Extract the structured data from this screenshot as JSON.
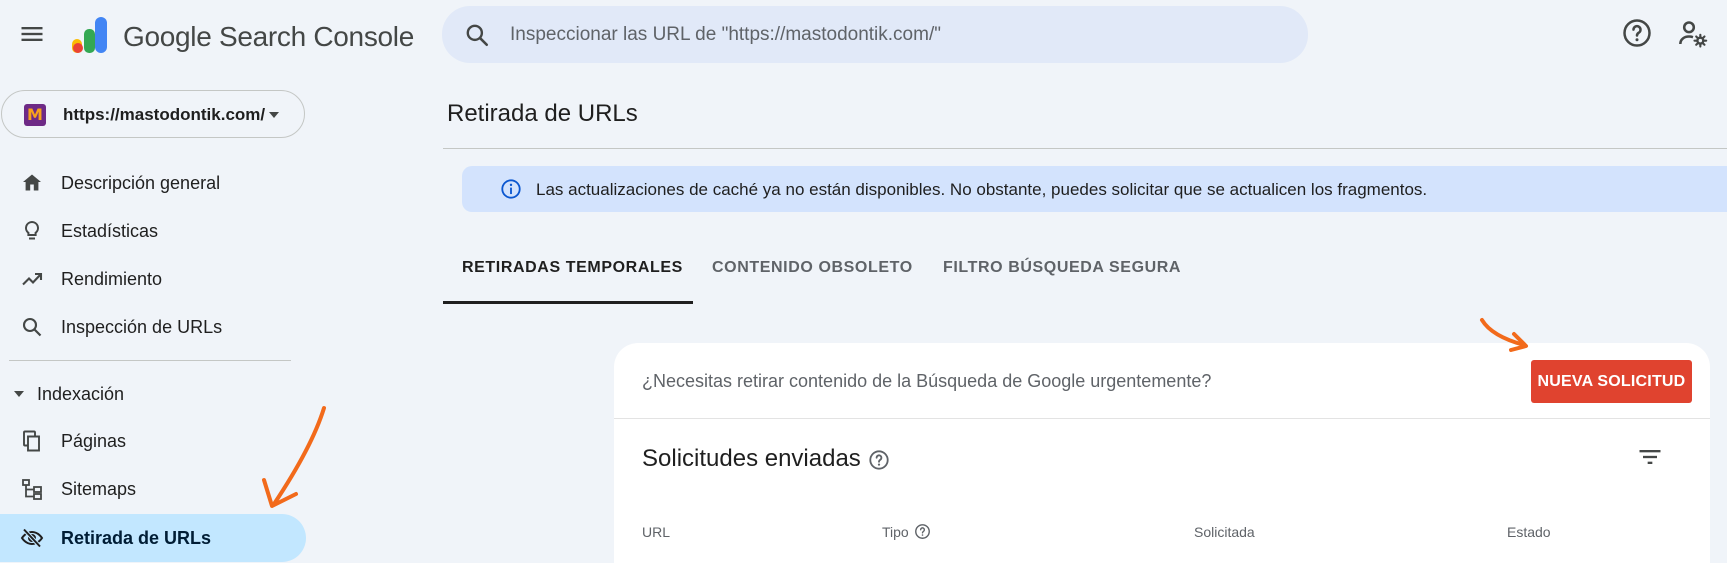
{
  "header": {
    "app_title": "Google Search Console",
    "search_placeholder": "Inspeccionar las URL de \"https://mastodontik.com/\"",
    "icons": [
      "menu-icon",
      "search-icon",
      "help-icon",
      "admin-settings-icon"
    ]
  },
  "sidebar": {
    "property_url": "https://mastodontik.com/",
    "property_favicon_letter": "M",
    "items": [
      {
        "label": "Descripción general",
        "icon": "home-icon"
      },
      {
        "label": "Estadísticas",
        "icon": "lightbulb-icon"
      },
      {
        "label": "Rendimiento",
        "icon": "trending-up-icon"
      },
      {
        "label": "Inspección de URLs",
        "icon": "search-icon"
      }
    ],
    "section_label": "Indexación",
    "index_items": [
      {
        "label": "Páginas",
        "icon": "pages-icon"
      },
      {
        "label": "Sitemaps",
        "icon": "sitemap-icon"
      },
      {
        "label": "Retirada de URLs",
        "icon": "visibility-off-icon",
        "active": true
      }
    ]
  },
  "main": {
    "page_title": "Retirada de URLs",
    "banner_text": "Las actualizaciones de caché ya no están disponibles. No obstante, puedes solicitar que se actualicen los fragmentos.",
    "tabs": [
      {
        "label": "RETIRADAS TEMPORALES",
        "active": true
      },
      {
        "label": "CONTENIDO OBSOLETO",
        "active": false
      },
      {
        "label": "FILTRO BÚSQUEDA SEGURA",
        "active": false
      }
    ],
    "card": {
      "question": "¿Necesitas retirar contenido de la Búsqueda de Google urgentemente?",
      "new_request_label": "NUEVA SOLICITUD",
      "section_title": "Solicitudes enviadas",
      "columns": [
        "URL",
        "Tipo",
        "Solicitada",
        "Estado"
      ]
    }
  },
  "colors": {
    "accent_red": "#e0432f",
    "active_nav": "#c2e7ff",
    "banner": "#d3e3fd",
    "annotation_arrow": "#f26a1b"
  }
}
